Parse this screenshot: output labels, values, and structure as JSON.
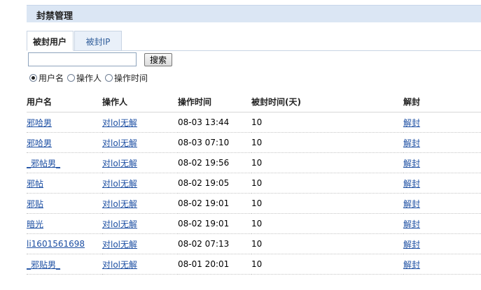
{
  "header": {
    "title": "封禁管理"
  },
  "tabs": [
    {
      "label": "被封用户",
      "active": true
    },
    {
      "label": "被封IP",
      "active": false
    }
  ],
  "search": {
    "value": "",
    "placeholder": "",
    "button_label": "搜索"
  },
  "filter_options": [
    {
      "label": "用户名",
      "checked": true
    },
    {
      "label": "操作人",
      "checked": false
    },
    {
      "label": "操作时间",
      "checked": false
    }
  ],
  "table": {
    "columns": [
      "用户名",
      "操作人",
      "操作时间",
      "被封时间(天)",
      "解封"
    ],
    "rows": [
      {
        "username": "邪哈男",
        "operator": "对lol无解",
        "time": "08-03 13:44",
        "days": "10",
        "action": "解封"
      },
      {
        "username": "邪哈男",
        "operator": "对lol无解",
        "time": "08-03 07:10",
        "days": "10",
        "action": "解封"
      },
      {
        "username": "_邪帖男_",
        "operator": "对lol无解",
        "time": "08-02 19:56",
        "days": "10",
        "action": "解封"
      },
      {
        "username": "邪帖",
        "operator": "对lol无解",
        "time": "08-02 19:05",
        "days": "10",
        "action": "解封"
      },
      {
        "username": "邪贴",
        "operator": "对lol无解",
        "time": "08-02 19:01",
        "days": "10",
        "action": "解封"
      },
      {
        "username": "暗光",
        "operator": "对lol无解",
        "time": "08-02 19:01",
        "days": "10",
        "action": "解封"
      },
      {
        "username": "li1601561698",
        "operator": "对lol无解",
        "time": "08-02 07:13",
        "days": "10",
        "action": "解封"
      },
      {
        "username": "_邪贴男_",
        "operator": "对lol无解",
        "time": "08-01 20:01",
        "days": "10",
        "action": "解封"
      }
    ]
  },
  "colors": {
    "header_bg": "#dbe6f4",
    "link": "#1d4fa3"
  }
}
